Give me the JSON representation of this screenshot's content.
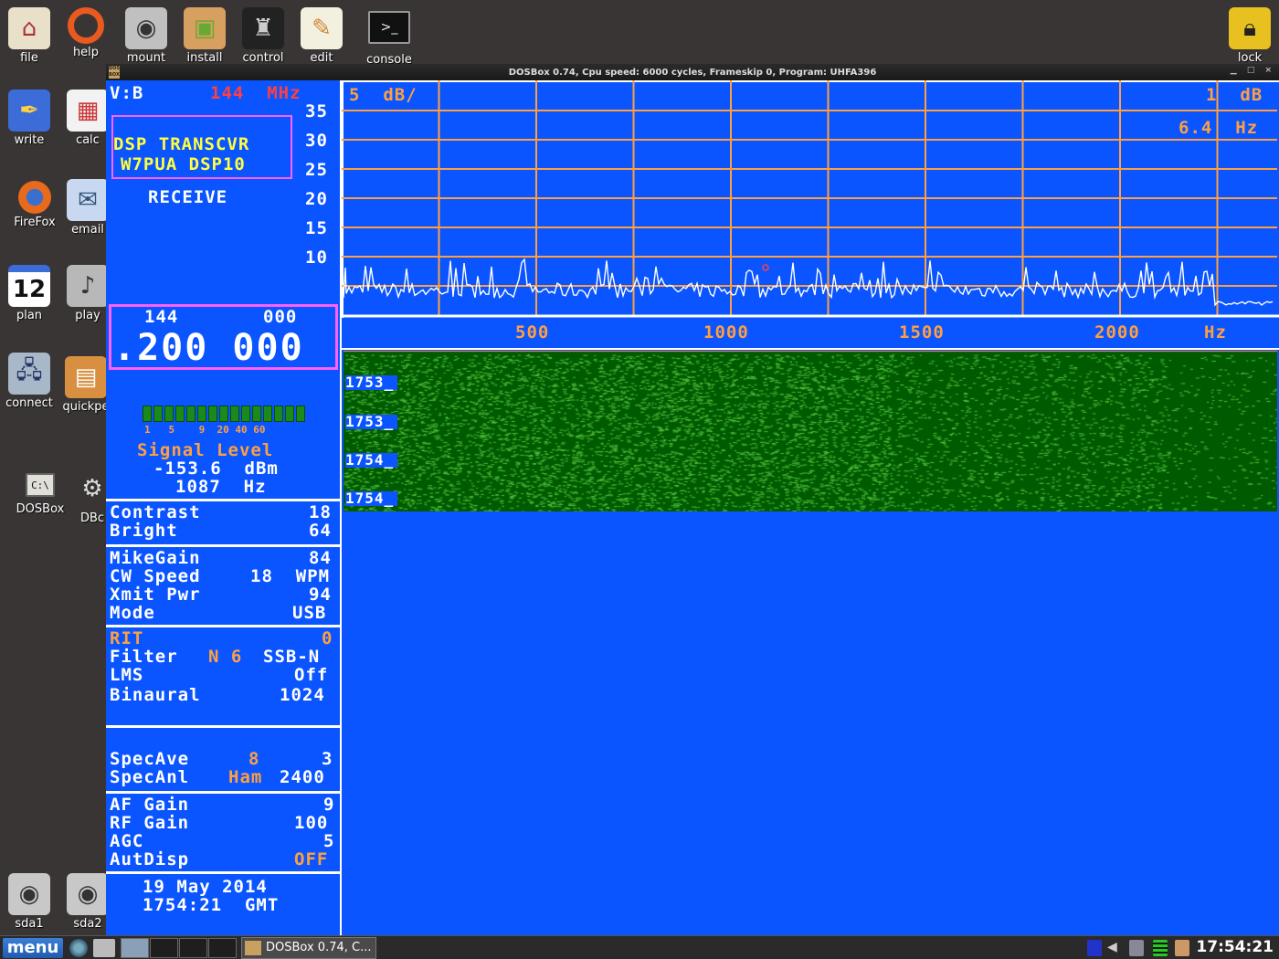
{
  "desktop": {
    "icons": [
      {
        "label": "file",
        "icon": "house-icon"
      },
      {
        "label": "help",
        "icon": "lifebuoy-icon"
      },
      {
        "label": "mount",
        "icon": "harddisk-icon"
      },
      {
        "label": "install",
        "icon": "package-icon"
      },
      {
        "label": "control",
        "icon": "tophat-icon"
      },
      {
        "label": "edit",
        "icon": "notepad-icon"
      },
      {
        "label": "console",
        "icon": "terminal-icon"
      },
      {
        "label": "lock",
        "icon": "padlock-icon"
      },
      {
        "label": "write",
        "icon": "pen-icon"
      },
      {
        "label": "calc",
        "icon": "spreadsheet-icon"
      },
      {
        "label": "FireFox",
        "icon": "firefox-icon"
      },
      {
        "label": "email",
        "icon": "mail-icon"
      },
      {
        "label": "plan",
        "icon": "calendar-icon",
        "glyph": "12"
      },
      {
        "label": "play",
        "icon": "speaker-icon"
      },
      {
        "label": "connect",
        "icon": "network-icon"
      },
      {
        "label": "quickpe",
        "icon": "puppy-box-icon"
      },
      {
        "label": "DOSBox",
        "icon": "dosbox-icon",
        "glyph": "C:\\"
      },
      {
        "label": "DBc",
        "icon": "gear-icon"
      },
      {
        "label": "sda1",
        "icon": "drive-icon"
      },
      {
        "label": "sda2",
        "icon": "drive-icon"
      }
    ]
  },
  "window": {
    "title": "DOSBox 0.74, Cpu speed:     6000 cycles, Frameskip  0, Program:  UHFA396"
  },
  "dsp": {
    "vfo": "V:B",
    "band": "144  MHz",
    "banner_line1": "DSP TRANSCVR",
    "banner_line2": "W7PUA DSP10",
    "state": "RECEIVE",
    "scale_labels": [
      "35",
      "30",
      "25",
      "20",
      "15",
      "10"
    ],
    "freq_mhz": "144",
    "freq_khz": "000",
    "freq_main": ".200 000",
    "meter_segments": 15,
    "meter_scale": "1   5    9  20 40 60",
    "signal_label": "Signal Level",
    "signal_dbm": "-153.6  dBm",
    "signal_hz": "1087  Hz",
    "contrast_label": "Contrast",
    "contrast_value": "18",
    "bright_label": "Bright",
    "bright_value": "64",
    "mikegain_label": "MikeGain",
    "mikegain_value": "84",
    "cwspeed_label": "CW Speed",
    "cwspeed_value": "18  WPM",
    "xmitpwr_label": "Xmit Pwr",
    "xmitpwr_value": "94",
    "mode_label": "Mode",
    "mode_value": "USB",
    "rit_label": "RIT",
    "rit_value": "0",
    "filter_label": "Filter",
    "filter_code": "N 6",
    "filter_value": "SSB-N",
    "lms_label": "LMS",
    "lms_value": "Off",
    "binaural_label": "Binaural",
    "binaural_value": "1024",
    "specave_label": "SpecAve",
    "specave_a": "8",
    "specave_b": "3",
    "specanl_label": "SpecAnl",
    "specanl_a": "Ham",
    "specanl_b": "2400",
    "afgain_label": "AF Gain",
    "afgain_value": "9",
    "rfgain_label": "RF Gain",
    "rfgain_value": "100",
    "agc_label": "AGC",
    "agc_value": "5",
    "autdisp_label": "AutDisp",
    "autdisp_value": "OFF",
    "date": "19 May 2014",
    "time": "1754:21  GMT"
  },
  "spectrum": {
    "scale_left": "5  dB/",
    "scale_right": "1  dB",
    "resolution": "6.4  Hz",
    "x_labels": [
      "500",
      "1000",
      "1500",
      "2000"
    ],
    "x_unit": "Hz",
    "grid_color": "#ffa040",
    "trace_color": "#ffffff"
  },
  "waterfall": {
    "time_labels": [
      "1753_",
      "1753_",
      "1754_",
      "1754_"
    ],
    "bg_color": "#005a00",
    "speckle_color": "#4cbf3a"
  },
  "taskbar": {
    "menu_label": "menu",
    "task_label": "DOSBox 0.74, C...",
    "clock": "17:54:21"
  }
}
